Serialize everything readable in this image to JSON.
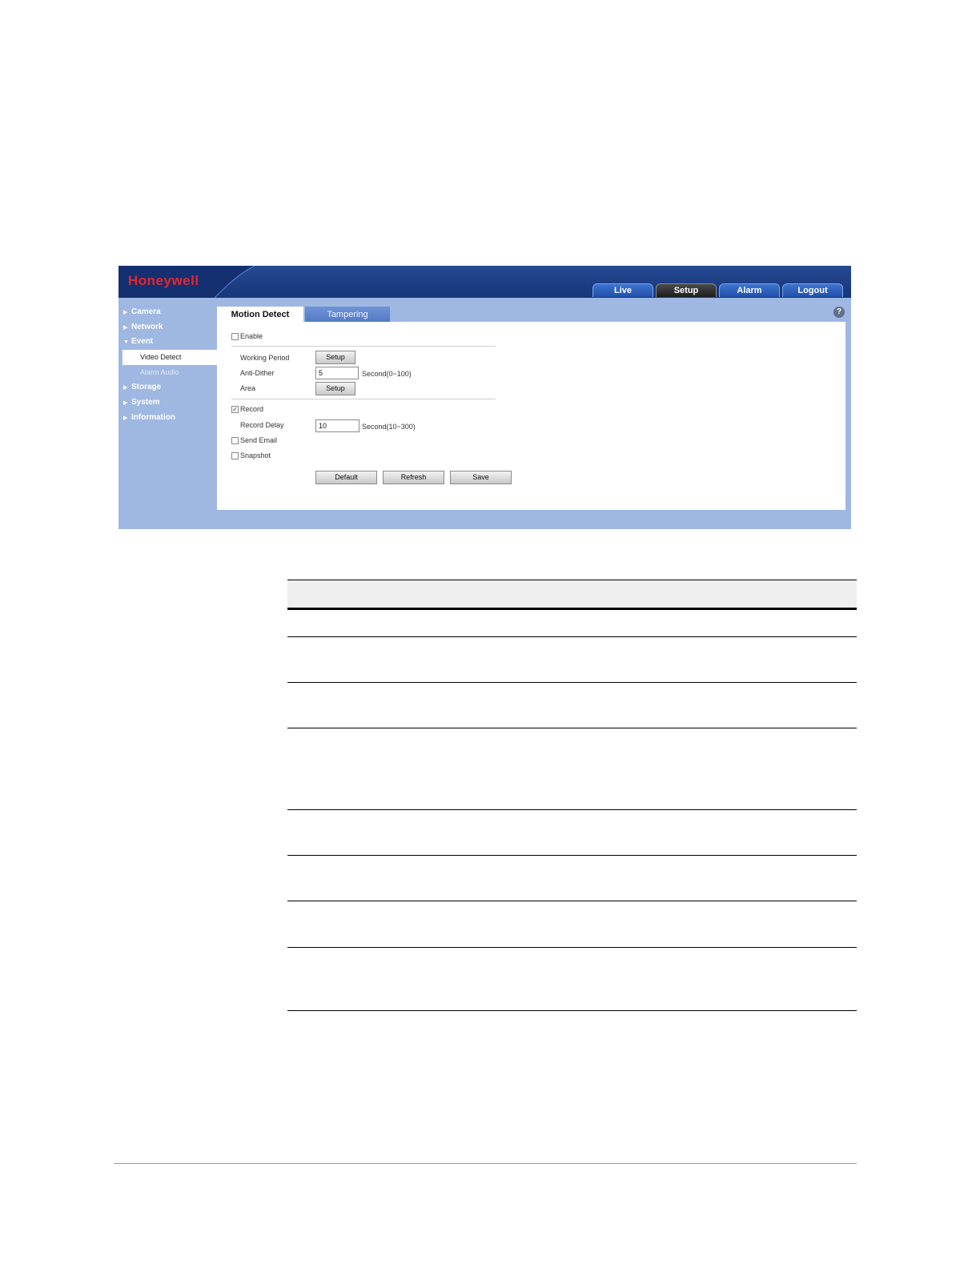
{
  "app": {
    "logo": "Honeywell",
    "top_tabs": [
      {
        "label": "Live",
        "active": false
      },
      {
        "label": "Setup",
        "active": true
      },
      {
        "label": "Alarm",
        "active": false
      },
      {
        "label": "Logout",
        "active": false
      }
    ],
    "sidebar": {
      "items": [
        {
          "label": "Camera",
          "expanded": false
        },
        {
          "label": "Network",
          "expanded": false
        },
        {
          "label": "Event",
          "expanded": true
        },
        {
          "label": "Storage",
          "expanded": false
        },
        {
          "label": "System",
          "expanded": false
        },
        {
          "label": "Information",
          "expanded": false
        }
      ],
      "event_subitems": [
        {
          "label": "Video Detect",
          "selected": true
        },
        {
          "label": "Alarm Audio",
          "selected": false
        }
      ]
    },
    "content_tabs": [
      {
        "label": "Motion Detect",
        "active": true
      },
      {
        "label": "Tampering",
        "active": false
      }
    ],
    "help_icon": "?",
    "form": {
      "enable": {
        "label": "Enable",
        "checked": false
      },
      "working_period": {
        "label": "Working Period",
        "button": "Setup"
      },
      "anti_dither": {
        "label": "Anti-Dither",
        "value": "5",
        "hint": "Second(0~100)"
      },
      "area": {
        "label": "Area",
        "button": "Setup"
      },
      "record": {
        "label": "Record",
        "checked": true
      },
      "record_delay": {
        "label": "Record Delay",
        "value": "10",
        "hint": "Second(10~300)"
      },
      "send_email": {
        "label": "Send Email",
        "checked": false
      },
      "snapshot": {
        "label": "Snapshot",
        "checked": false
      },
      "buttons": {
        "default": "Default",
        "refresh": "Refresh",
        "save": "Save"
      }
    },
    "colors": {
      "header": "#1f438c",
      "logo": "#e8262c",
      "sidebar": "#9fb8e2",
      "active_tab": "#2b2b2b"
    }
  }
}
